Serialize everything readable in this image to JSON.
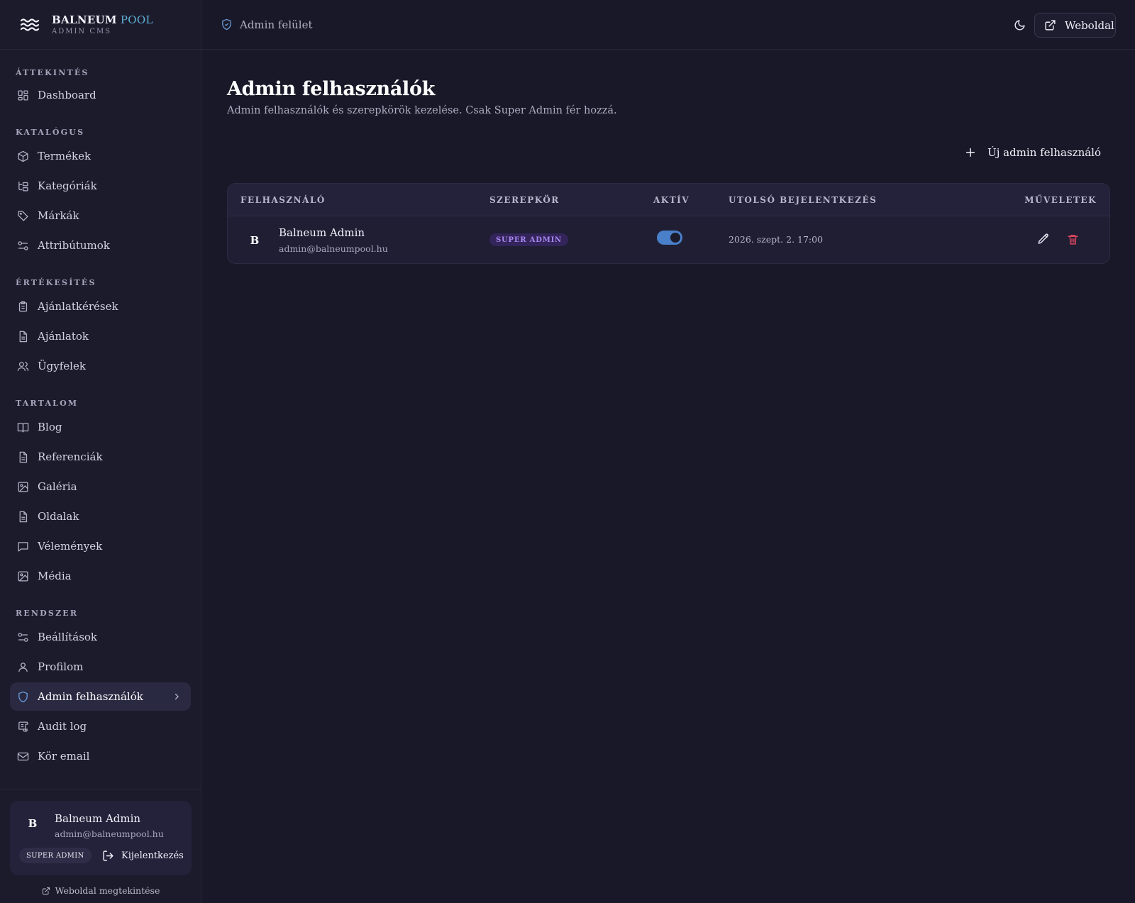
{
  "brand": {
    "name_main": "BALNEUM",
    "name_accent": " POOL",
    "subtitle": "ADMIN CMS"
  },
  "sidebar": {
    "sections": [
      {
        "title": "ÁTTEKINTÉS",
        "items": [
          {
            "label": "Dashboard",
            "icon": "dashboard-icon"
          }
        ]
      },
      {
        "title": "KATALÓGUS",
        "items": [
          {
            "label": "Termékek",
            "icon": "package-icon"
          },
          {
            "label": "Kategóriák",
            "icon": "tree-icon"
          },
          {
            "label": "Márkák",
            "icon": "tag-icon"
          },
          {
            "label": "Attribútumok",
            "icon": "sliders-icon"
          }
        ]
      },
      {
        "title": "ÉRTÉKESÍTÉS",
        "items": [
          {
            "label": "Ajánlatkérések",
            "icon": "clipboard-icon"
          },
          {
            "label": "Ajánlatok",
            "icon": "document-icon"
          },
          {
            "label": "Ügyfelek",
            "icon": "users-icon"
          }
        ]
      },
      {
        "title": "TARTALOM",
        "items": [
          {
            "label": "Blog",
            "icon": "book-icon"
          },
          {
            "label": "Referenciák",
            "icon": "document-icon"
          },
          {
            "label": "Galéria",
            "icon": "image-icon"
          },
          {
            "label": "Oldalak",
            "icon": "document-icon"
          },
          {
            "label": "Vélemények",
            "icon": "message-icon"
          },
          {
            "label": "Média",
            "icon": "image-icon"
          }
        ]
      },
      {
        "title": "RENDSZER",
        "items": [
          {
            "label": "Beállítások",
            "icon": "sliders-icon"
          },
          {
            "label": "Profilom",
            "icon": "user-icon"
          },
          {
            "label": "Admin felhasználók",
            "icon": "shield-icon",
            "active": true
          },
          {
            "label": "Audit log",
            "icon": "scroll-icon"
          },
          {
            "label": "Kör email",
            "icon": "mail-icon"
          }
        ]
      }
    ]
  },
  "user_card": {
    "initial": "B",
    "name": "Balneum Admin",
    "email": "admin@balneumpool.hu",
    "role": "SUPER ADMIN",
    "logout_label": "Kijelentkezés",
    "view_site_label": "Weboldal megtekintése"
  },
  "topbar": {
    "breadcrumb": "Admin felület",
    "site_button_label": "Weboldal"
  },
  "main": {
    "title": "Admin felhasználók",
    "subtitle": "Admin felhasználók és szerepkörök kezelése. Csak Super Admin fér hozzá.",
    "new_button_label": "Új admin felhasználó",
    "table": {
      "headers": {
        "user": "FELHASZNÁLÓ",
        "role": "SZEREPKÖR",
        "active": "AKTÍV",
        "last_login": "UTOLSÓ BEJELENTKEZÉS",
        "actions": "MŰVELETEK"
      },
      "rows": [
        {
          "initial": "B",
          "name": "Balneum Admin",
          "email": "admin@balneumpool.hu",
          "role": "SUPER ADMIN",
          "active": true,
          "last_login": "2026. szept. 2. 17:00"
        }
      ]
    }
  },
  "colors": {
    "background": "#191828",
    "sidebar": "#1c1b2c",
    "accent": "#5fb2d8",
    "toggle_on": "#4a7fc9",
    "role_badge_text": "#a987f2",
    "delete": "#e0475f"
  }
}
